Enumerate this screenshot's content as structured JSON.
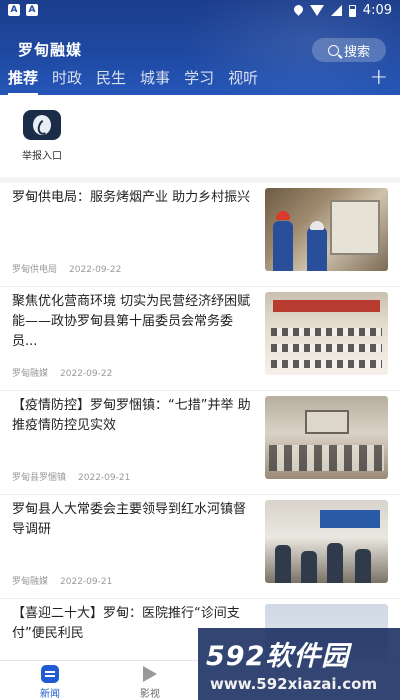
{
  "status_bar": {
    "time": "4:09",
    "left_icons": [
      "A",
      "A"
    ]
  },
  "header": {
    "brand": "罗甸融媒",
    "search_label": "搜索",
    "tabs": [
      {
        "label": "推荐",
        "active": true
      },
      {
        "label": "时政",
        "active": false
      },
      {
        "label": "民生",
        "active": false
      },
      {
        "label": "城事",
        "active": false
      },
      {
        "label": "学习",
        "active": false
      },
      {
        "label": "视听",
        "active": false
      }
    ],
    "plus_label": "+"
  },
  "quick_entries": [
    {
      "label": "举报入口",
      "icon": "phone-icon"
    }
  ],
  "news": [
    {
      "title": "罗甸供电局：服务烤烟产业 助力乡村振兴",
      "source": "罗甸供电局",
      "date": "2022-09-22"
    },
    {
      "title": "聚焦优化营商环境 切实为民营经济纾困赋能——政协罗甸县第十届委员会常务委员...",
      "source": "罗甸融媒",
      "date": "2022-09-22"
    },
    {
      "title": "【疫情防控】罗甸罗悃镇：“七措”并举 助推疫情防控见实效",
      "source": "罗甸县罗悃镇",
      "date": "2022-09-21"
    },
    {
      "title": "罗甸县人大常委会主要领导到红水河镇督导调研",
      "source": "罗甸融媒",
      "date": "2022-09-21"
    },
    {
      "title": "【喜迎二十大】罗甸：医院推行“诊间支付”便民利民",
      "source": "",
      "date": ""
    }
  ],
  "bottom_nav": [
    {
      "label": "新闻",
      "icon": "news-icon",
      "active": true
    },
    {
      "label": "影视",
      "icon": "play-icon",
      "active": false
    }
  ],
  "overlay": {
    "title": "592软件园",
    "url": "www.592xiazai.com"
  },
  "colors": {
    "header": "#1f4aa3",
    "accent": "#1f5bd1"
  }
}
